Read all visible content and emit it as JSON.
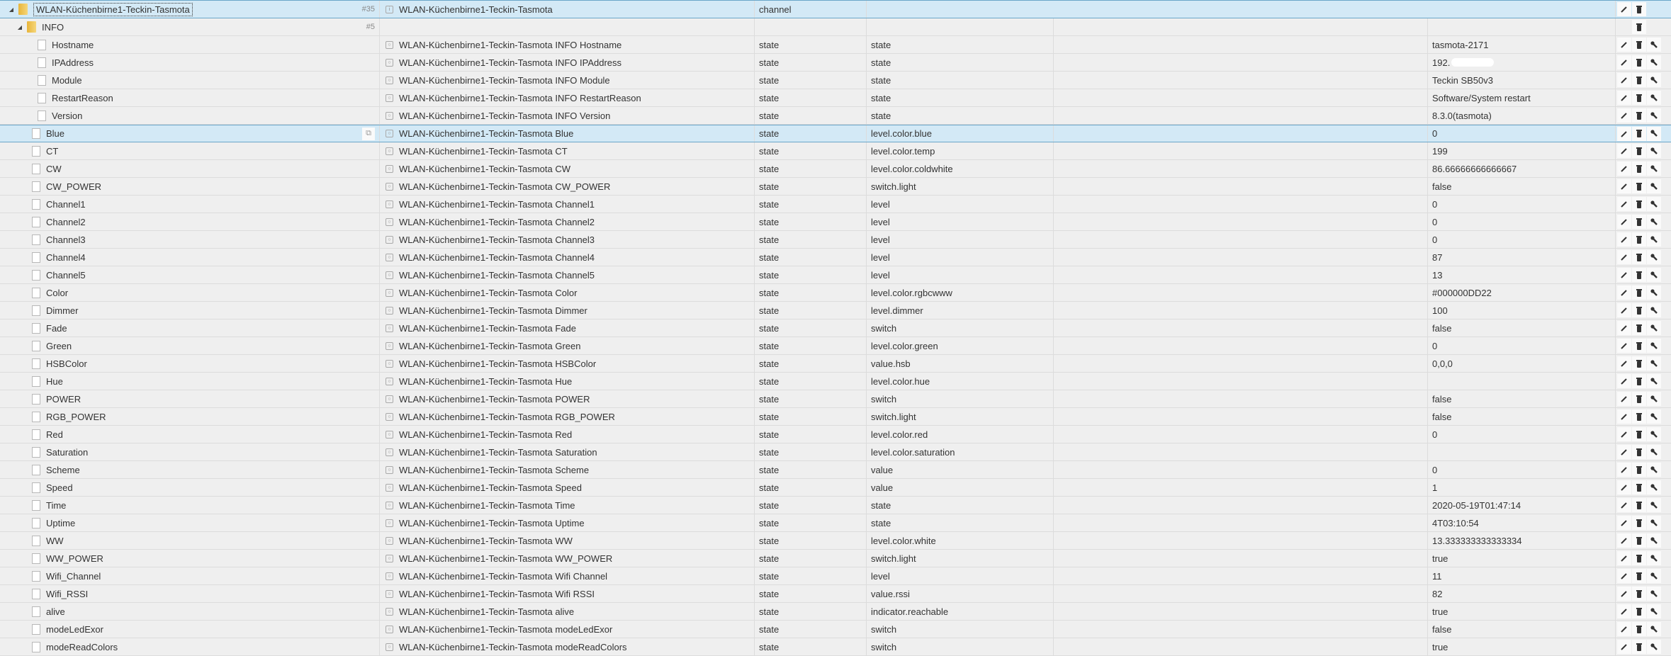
{
  "channel": {
    "name": "WLAN-Küchenbirne1-Teckin-Tasmota",
    "count": "#35",
    "fullname": "WLAN-Küchenbirne1-Teckin-Tasmota",
    "type": "channel"
  },
  "info": {
    "name": "INFO",
    "count": "#5"
  },
  "info_states": [
    {
      "id": "Hostname",
      "name": "WLAN-Küchenbirne1-Teckin-Tasmota INFO Hostname",
      "type": "state",
      "role": "state",
      "value": "tasmota-2171"
    },
    {
      "id": "IPAddress",
      "name": "WLAN-Küchenbirne1-Teckin-Tasmota INFO IPAddress",
      "type": "state",
      "role": "state",
      "value": "192."
    },
    {
      "id": "Module",
      "name": "WLAN-Küchenbirne1-Teckin-Tasmota INFO Module",
      "type": "state",
      "role": "state",
      "value": "Teckin SB50v3"
    },
    {
      "id": "RestartReason",
      "name": "WLAN-Küchenbirne1-Teckin-Tasmota INFO RestartReason",
      "type": "state",
      "role": "state",
      "value": "Software/System restart"
    },
    {
      "id": "Version",
      "name": "WLAN-Küchenbirne1-Teckin-Tasmota INFO Version",
      "type": "state",
      "role": "state",
      "value": "8.3.0(tasmota)"
    }
  ],
  "states": [
    {
      "id": "Blue",
      "name": "WLAN-Küchenbirne1-Teckin-Tasmota Blue",
      "type": "state",
      "role": "level.color.blue",
      "value": "0"
    },
    {
      "id": "CT",
      "name": "WLAN-Küchenbirne1-Teckin-Tasmota CT",
      "type": "state",
      "role": "level.color.temp",
      "value": "199"
    },
    {
      "id": "CW",
      "name": "WLAN-Küchenbirne1-Teckin-Tasmota CW",
      "type": "state",
      "role": "level.color.coldwhite",
      "value": "86.66666666666667"
    },
    {
      "id": "CW_POWER",
      "name": "WLAN-Küchenbirne1-Teckin-Tasmota CW_POWER",
      "type": "state",
      "role": "switch.light",
      "value": "false"
    },
    {
      "id": "Channel1",
      "name": "WLAN-Küchenbirne1-Teckin-Tasmota Channel1",
      "type": "state",
      "role": "level",
      "value": "0"
    },
    {
      "id": "Channel2",
      "name": "WLAN-Küchenbirne1-Teckin-Tasmota Channel2",
      "type": "state",
      "role": "level",
      "value": "0"
    },
    {
      "id": "Channel3",
      "name": "WLAN-Küchenbirne1-Teckin-Tasmota Channel3",
      "type": "state",
      "role": "level",
      "value": "0"
    },
    {
      "id": "Channel4",
      "name": "WLAN-Küchenbirne1-Teckin-Tasmota Channel4",
      "type": "state",
      "role": "level",
      "value": "87"
    },
    {
      "id": "Channel5",
      "name": "WLAN-Küchenbirne1-Teckin-Tasmota Channel5",
      "type": "state",
      "role": "level",
      "value": "13"
    },
    {
      "id": "Color",
      "name": "WLAN-Küchenbirne1-Teckin-Tasmota Color",
      "type": "state",
      "role": "level.color.rgbcwww",
      "value": "#000000DD22"
    },
    {
      "id": "Dimmer",
      "name": "WLAN-Küchenbirne1-Teckin-Tasmota Dimmer",
      "type": "state",
      "role": "level.dimmer",
      "value": "100"
    },
    {
      "id": "Fade",
      "name": "WLAN-Küchenbirne1-Teckin-Tasmota Fade",
      "type": "state",
      "role": "switch",
      "value": "false"
    },
    {
      "id": "Green",
      "name": "WLAN-Küchenbirne1-Teckin-Tasmota Green",
      "type": "state",
      "role": "level.color.green",
      "value": "0"
    },
    {
      "id": "HSBColor",
      "name": "WLAN-Küchenbirne1-Teckin-Tasmota HSBColor",
      "type": "state",
      "role": "value.hsb",
      "value": "0,0,0"
    },
    {
      "id": "Hue",
      "name": "WLAN-Küchenbirne1-Teckin-Tasmota Hue",
      "type": "state",
      "role": "level.color.hue",
      "value": ""
    },
    {
      "id": "POWER",
      "name": "WLAN-Küchenbirne1-Teckin-Tasmota POWER",
      "type": "state",
      "role": "switch",
      "value": "false"
    },
    {
      "id": "RGB_POWER",
      "name": "WLAN-Küchenbirne1-Teckin-Tasmota RGB_POWER",
      "type": "state",
      "role": "switch.light",
      "value": "false"
    },
    {
      "id": "Red",
      "name": "WLAN-Küchenbirne1-Teckin-Tasmota Red",
      "type": "state",
      "role": "level.color.red",
      "value": "0"
    },
    {
      "id": "Saturation",
      "name": "WLAN-Küchenbirne1-Teckin-Tasmota Saturation",
      "type": "state",
      "role": "level.color.saturation",
      "value": ""
    },
    {
      "id": "Scheme",
      "name": "WLAN-Küchenbirne1-Teckin-Tasmota Scheme",
      "type": "state",
      "role": "value",
      "value": "0"
    },
    {
      "id": "Speed",
      "name": "WLAN-Küchenbirne1-Teckin-Tasmota Speed",
      "type": "state",
      "role": "value",
      "value": "1"
    },
    {
      "id": "Time",
      "name": "WLAN-Küchenbirne1-Teckin-Tasmota Time",
      "type": "state",
      "role": "state",
      "value": "2020-05-19T01:47:14"
    },
    {
      "id": "Uptime",
      "name": "WLAN-Küchenbirne1-Teckin-Tasmota Uptime",
      "type": "state",
      "role": "state",
      "value": "4T03:10:54"
    },
    {
      "id": "WW",
      "name": "WLAN-Küchenbirne1-Teckin-Tasmota WW",
      "type": "state",
      "role": "level.color.white",
      "value": "13.333333333333334"
    },
    {
      "id": "WW_POWER",
      "name": "WLAN-Küchenbirne1-Teckin-Tasmota WW_POWER",
      "type": "state",
      "role": "switch.light",
      "value": "true"
    },
    {
      "id": "Wifi_Channel",
      "name": "WLAN-Küchenbirne1-Teckin-Tasmota Wifi Channel",
      "type": "state",
      "role": "level",
      "value": "11"
    },
    {
      "id": "Wifi_RSSI",
      "name": "WLAN-Küchenbirne1-Teckin-Tasmota Wifi RSSI",
      "type": "state",
      "role": "value.rssi",
      "value": "82"
    },
    {
      "id": "alive",
      "name": "WLAN-Küchenbirne1-Teckin-Tasmota alive",
      "type": "state",
      "role": "indicator.reachable",
      "value": "true"
    },
    {
      "id": "modeLedExor",
      "name": "WLAN-Küchenbirne1-Teckin-Tasmota modeLedExor",
      "type": "state",
      "role": "switch",
      "value": "false"
    },
    {
      "id": "modeReadColors",
      "name": "WLAN-Küchenbirne1-Teckin-Tasmota modeReadColors",
      "type": "state",
      "role": "switch",
      "value": "true"
    }
  ],
  "icons": {
    "edit": "pencil-icon",
    "delete": "trash-icon",
    "settings": "wrench-icon",
    "copy": "copy-icon"
  }
}
